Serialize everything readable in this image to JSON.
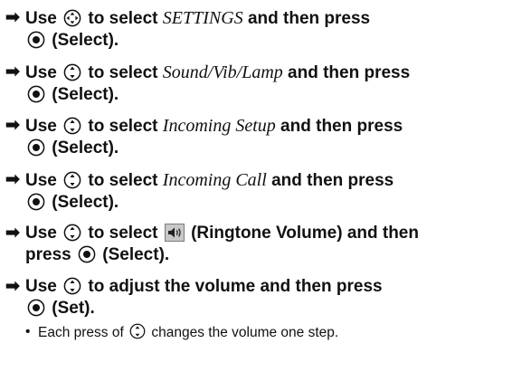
{
  "steps": [
    {
      "l1a": "Use ",
      "l1b": " to select ",
      "term": "SETTINGS",
      "l1c": " and then press",
      "l2a": " (Select).",
      "nav": "multi-nav-key-icon"
    },
    {
      "l1a": "Use ",
      "l1b": " to select ",
      "term": "Sound/Vib/Lamp",
      "l1c": " and then press",
      "l2a": " (Select).",
      "nav": "up-down-nav-key-icon"
    },
    {
      "l1a": "Use ",
      "l1b": " to select ",
      "term": "Incoming Setup",
      "l1c": " and then press",
      "l2a": " (Select).",
      "nav": "up-down-nav-key-icon"
    },
    {
      "l1a": "Use ",
      "l1b": " to select ",
      "term": "Incoming Call",
      "l1c": " and then press",
      "l2a": " (Select).",
      "nav": "up-down-nav-key-icon"
    },
    {
      "l1a": "Use ",
      "l1b": " to select ",
      "l1c": " (Ringtone Volume) and then",
      "l2pre": "press ",
      "l2a": " (Select).",
      "nav": "up-down-nav-key-icon",
      "volume_icon": "ringtone-volume-icon"
    },
    {
      "l1a": "Use ",
      "l1b": " to adjust the volume and then press",
      "l2a": " (Set).",
      "nav": "up-down-nav-key-icon"
    }
  ],
  "note": {
    "bullet": "•",
    "a": "Each press of ",
    "b": " changes the volume one step."
  },
  "arrow": "➡"
}
